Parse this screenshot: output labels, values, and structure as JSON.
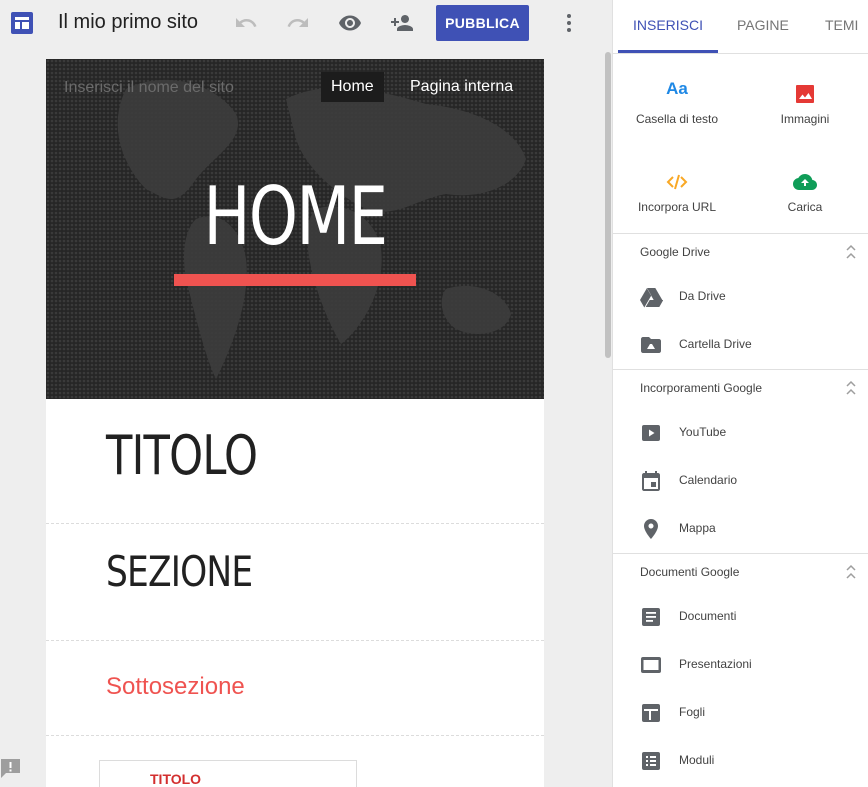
{
  "toolbar": {
    "site_title": "Il mio primo sito",
    "publish_label": "PUBBLICA"
  },
  "canvas": {
    "site_name_placeholder": "Inserisci il nome del sito",
    "nav": [
      "Home",
      "Pagina interna"
    ],
    "hero_title": "HOME",
    "title": "TITOLO",
    "section": "SEZIONE",
    "subsection": "Sottosezione",
    "card_title": "TITOLO"
  },
  "panel": {
    "tabs": [
      "INSERISCI",
      "PAGINE",
      "TEMI"
    ],
    "active_tab": "INSERISCI",
    "tools": [
      {
        "label": "Casella di testo",
        "icon": "Aa"
      },
      {
        "label": "Immagini",
        "icon": "image-icon"
      },
      {
        "label": "Incorpora URL",
        "icon": "embed-code-icon"
      },
      {
        "label": "Carica",
        "icon": "cloud-upload-icon"
      }
    ],
    "sections": [
      {
        "title": "Google Drive",
        "items": [
          "Da Drive",
          "Cartella Drive"
        ]
      },
      {
        "title": "Incorporamenti Google",
        "items": [
          "YouTube",
          "Calendario",
          "Mappa"
        ]
      },
      {
        "title": "Documenti Google",
        "items": [
          "Documenti",
          "Presentazioni",
          "Fogli",
          "Moduli"
        ]
      }
    ]
  },
  "colors": {
    "accent": "#3f51b5",
    "hero_underline": "#ef5350",
    "subsection": "#ef5350",
    "text_tool": "#1e88e5",
    "image_tool": "#e53935",
    "embed_tool": "#f9a825",
    "upload_tool": "#0f9d58"
  }
}
